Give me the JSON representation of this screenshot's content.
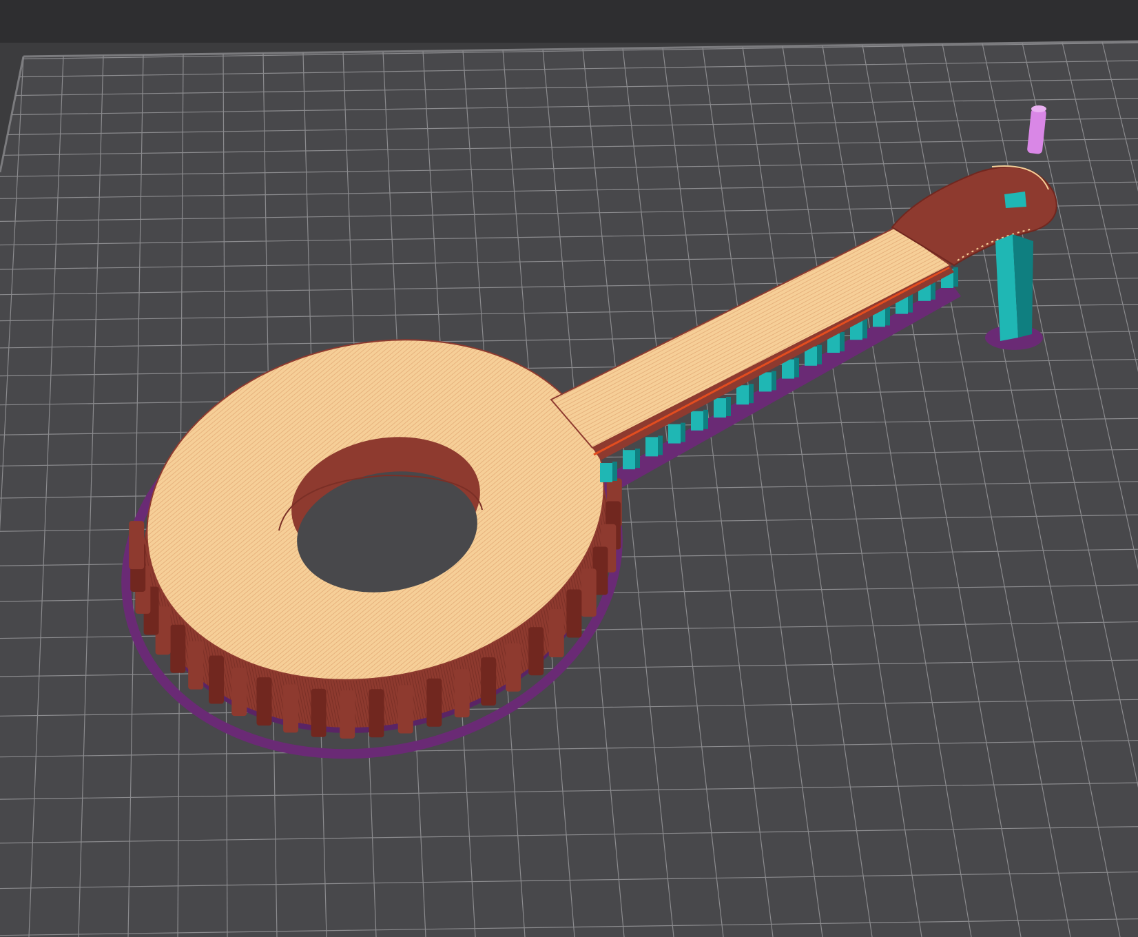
{
  "app": {
    "view": "slicer-preview-3d"
  },
  "scene": {
    "object": "gear-arm-part",
    "layers_visible": [
      "skirt-brim",
      "external-perimeter",
      "top-solid-infill",
      "support-material",
      "nozzle"
    ]
  },
  "colors": {
    "background_top": "#2e2e30",
    "background": "#3c3c3e",
    "bed": "#48484b",
    "grid_line": "#8b8b8e",
    "grid_edge": "#a7a7aa",
    "top_infill": "#f6cf98",
    "top_infill_stripe": "#e7b27d",
    "perimeter": "#8e3a2f",
    "perimeter_shadow": "#71271f",
    "skirt": "#6a2a75",
    "support": "#1fb7b4",
    "support_dark": "#0f7f80",
    "nozzle": "#d987e6",
    "infill_edge": "#e34d1f"
  }
}
